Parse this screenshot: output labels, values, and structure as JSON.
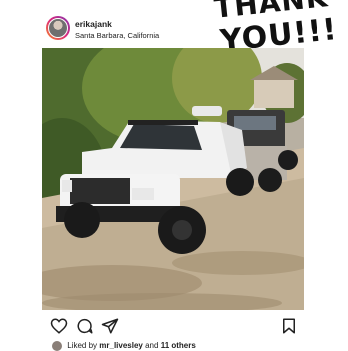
{
  "post": {
    "username": "erikajank",
    "location": "Santa Barbara, California"
  },
  "sticker": {
    "line1": "THANK",
    "line2": "YOU!!!"
  },
  "likes": {
    "prefix": "Liked by",
    "user": "mr_livesley",
    "connector": "and",
    "others": "11 others"
  },
  "icons": {
    "like": "heart-icon",
    "comment": "comment-icon",
    "share": "send-icon",
    "save": "bookmark-icon"
  }
}
